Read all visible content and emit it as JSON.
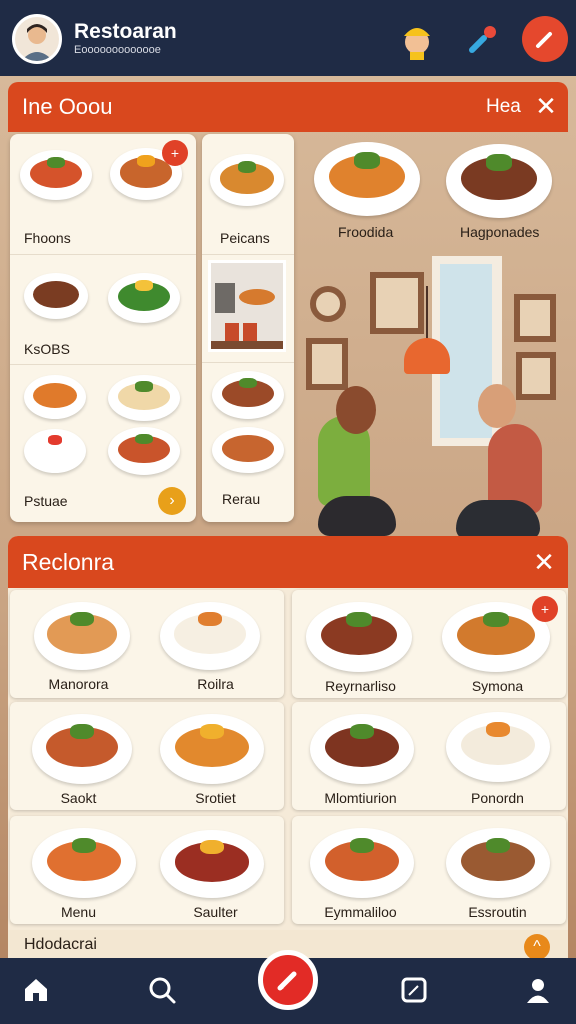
{
  "header": {
    "title": "Restoaran",
    "subtitle": "Eooooooooooooe",
    "icons": [
      "avatar-photo",
      "worker-emoji-icon",
      "pin-icon",
      "edit-icon"
    ]
  },
  "panel_top": {
    "title": "Ine Ooou",
    "right_label": "Hea",
    "close_icon": "close-icon",
    "column1": [
      {
        "label": "Fhoons"
      },
      {
        "label": "KsOBS"
      },
      {
        "label": "Pstuae",
        "action_icon": "arrow-right-icon"
      }
    ],
    "column2": [
      {
        "label": "Peicans"
      },
      {
        "label": ""
      },
      {
        "label": "Rerau"
      }
    ],
    "column3": [
      {
        "label": "Froodida"
      },
      {
        "label": "Hagponades"
      }
    ]
  },
  "panel_bottom": {
    "title": "Reclonra",
    "close_icon": "close-icon",
    "items": [
      {
        "label": "Manorora"
      },
      {
        "label": "Roilra"
      },
      {
        "label": "Reyrnarliso"
      },
      {
        "label": "Symona"
      },
      {
        "label": "Saokt"
      },
      {
        "label": "Srotiet"
      },
      {
        "label": "Mlomtiurion"
      },
      {
        "label": "Ponordn"
      },
      {
        "label": "Menu"
      },
      {
        "label": "Saulter"
      },
      {
        "label": "Eymmaliloo"
      },
      {
        "label": "Essroutin"
      }
    ]
  },
  "peek_section": {
    "label": "Hdodacrai"
  },
  "bottom_nav": [
    {
      "icon": "home-icon"
    },
    {
      "icon": "search-icon"
    },
    {
      "icon": "pen-icon"
    },
    {
      "icon": "tablet-icon"
    },
    {
      "icon": "profile-icon"
    }
  ],
  "colors": {
    "accent": "#d9481e",
    "nav_bg": "#1f2b45",
    "card_bg": "#fbf5e8",
    "fab": "#e22b26"
  }
}
